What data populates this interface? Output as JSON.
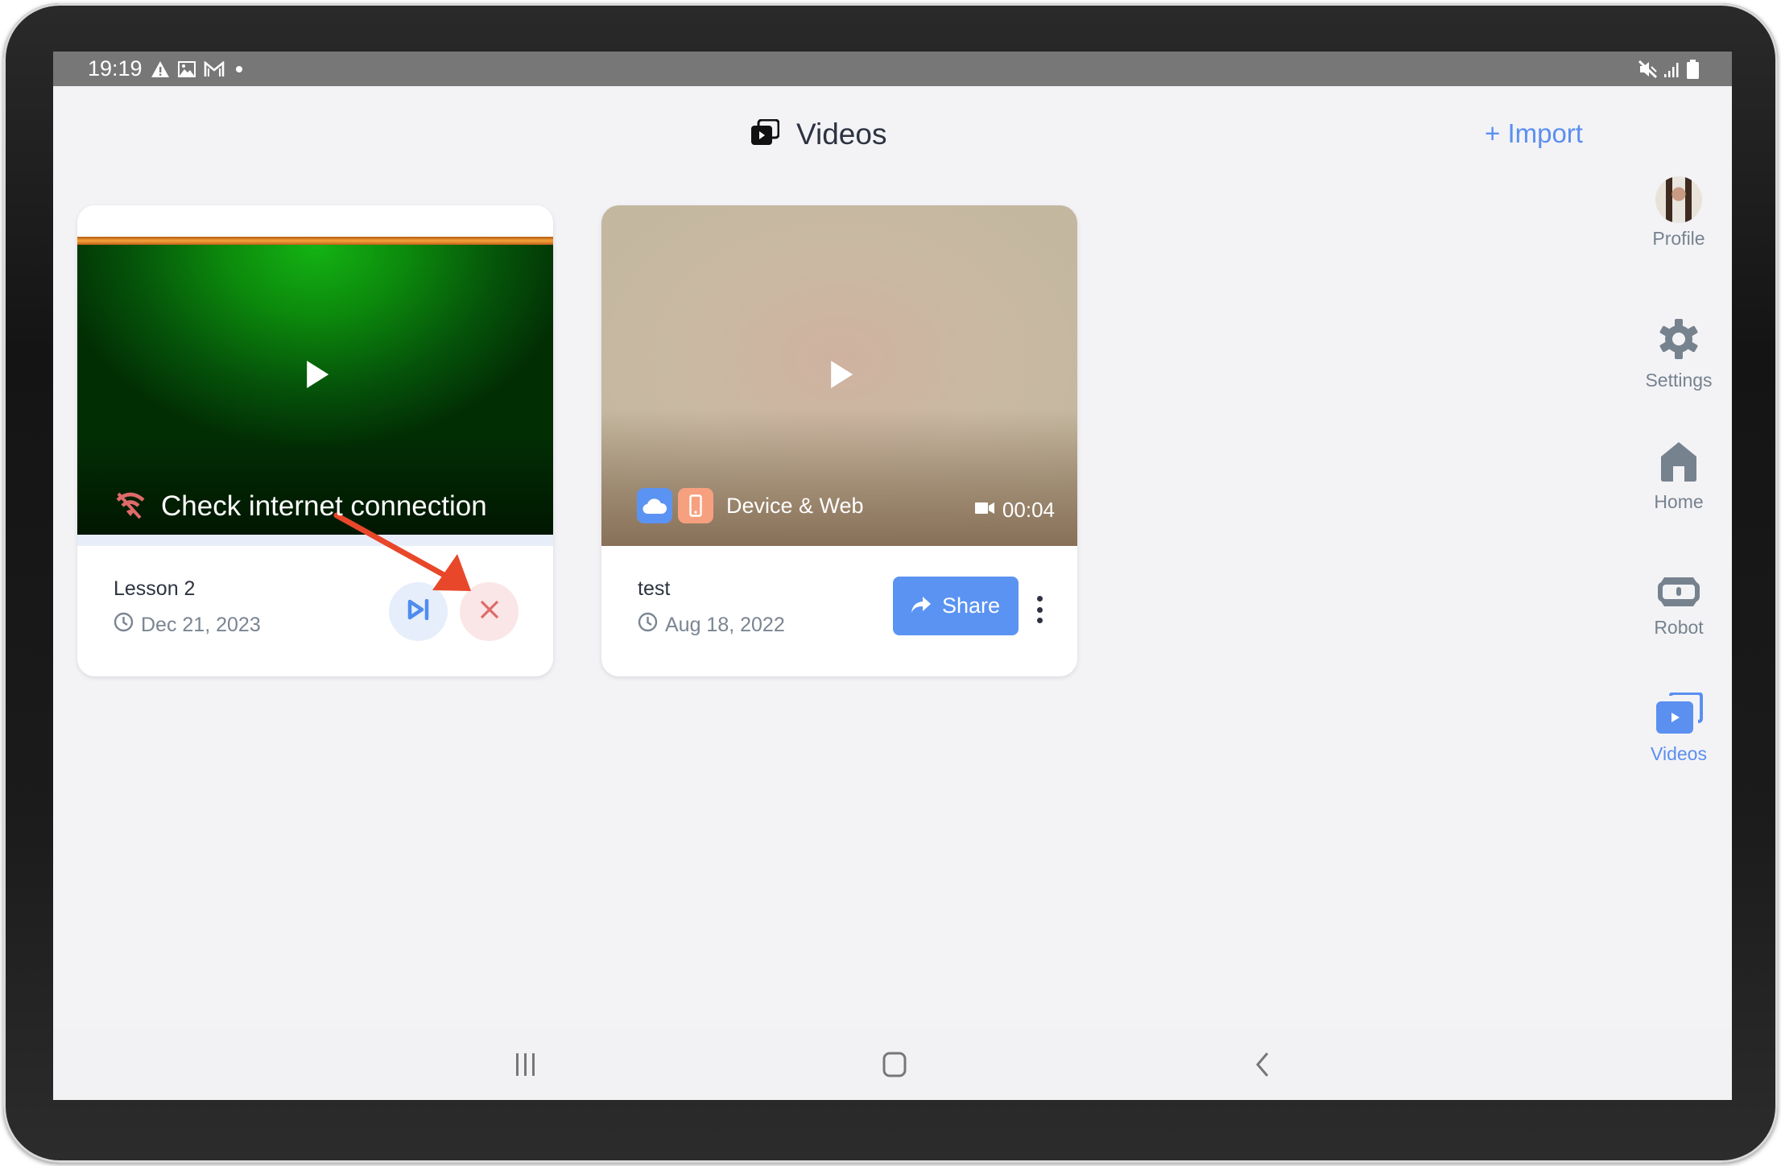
{
  "status_bar": {
    "time": "19:19",
    "left_icons": [
      "alert-icon",
      "image-icon",
      "gmail-icon",
      "dot-icon"
    ],
    "right_icons": [
      "mute-icon",
      "signal-icon",
      "battery-icon"
    ]
  },
  "header": {
    "title": "Videos",
    "title_icon": "videos-icon",
    "import_label": "+ Import"
  },
  "videos": [
    {
      "title": "Lesson 2",
      "date": "Dec 21, 2023",
      "status": "Check internet connection",
      "status_icon": "wifi-off-icon",
      "actions": [
        "resume-upload",
        "cancel-upload"
      ]
    },
    {
      "title": "test",
      "date": "Aug 18, 2022",
      "source_label": "Device & Web",
      "source_icons": [
        "cloud-icon",
        "phone-icon"
      ],
      "duration": "00:04",
      "share_label": "Share"
    }
  ],
  "sidebar": {
    "items": [
      {
        "label": "Profile",
        "icon": "avatar"
      },
      {
        "label": "Settings",
        "icon": "gear-icon"
      },
      {
        "label": "Home",
        "icon": "home-icon"
      },
      {
        "label": "Robot",
        "icon": "robot-icon"
      },
      {
        "label": "Videos",
        "icon": "videos-icon",
        "active": true
      }
    ]
  },
  "nav_bar": {
    "buttons": [
      "recents",
      "home",
      "back"
    ]
  },
  "colors": {
    "accent": "#5b8ff0",
    "share_button": "#5b93f2",
    "cancel": "#e06a6a",
    "cancel_bg": "#fae6e7",
    "resume_bg": "#e6eefb",
    "annotation_arrow": "#e8472a"
  }
}
